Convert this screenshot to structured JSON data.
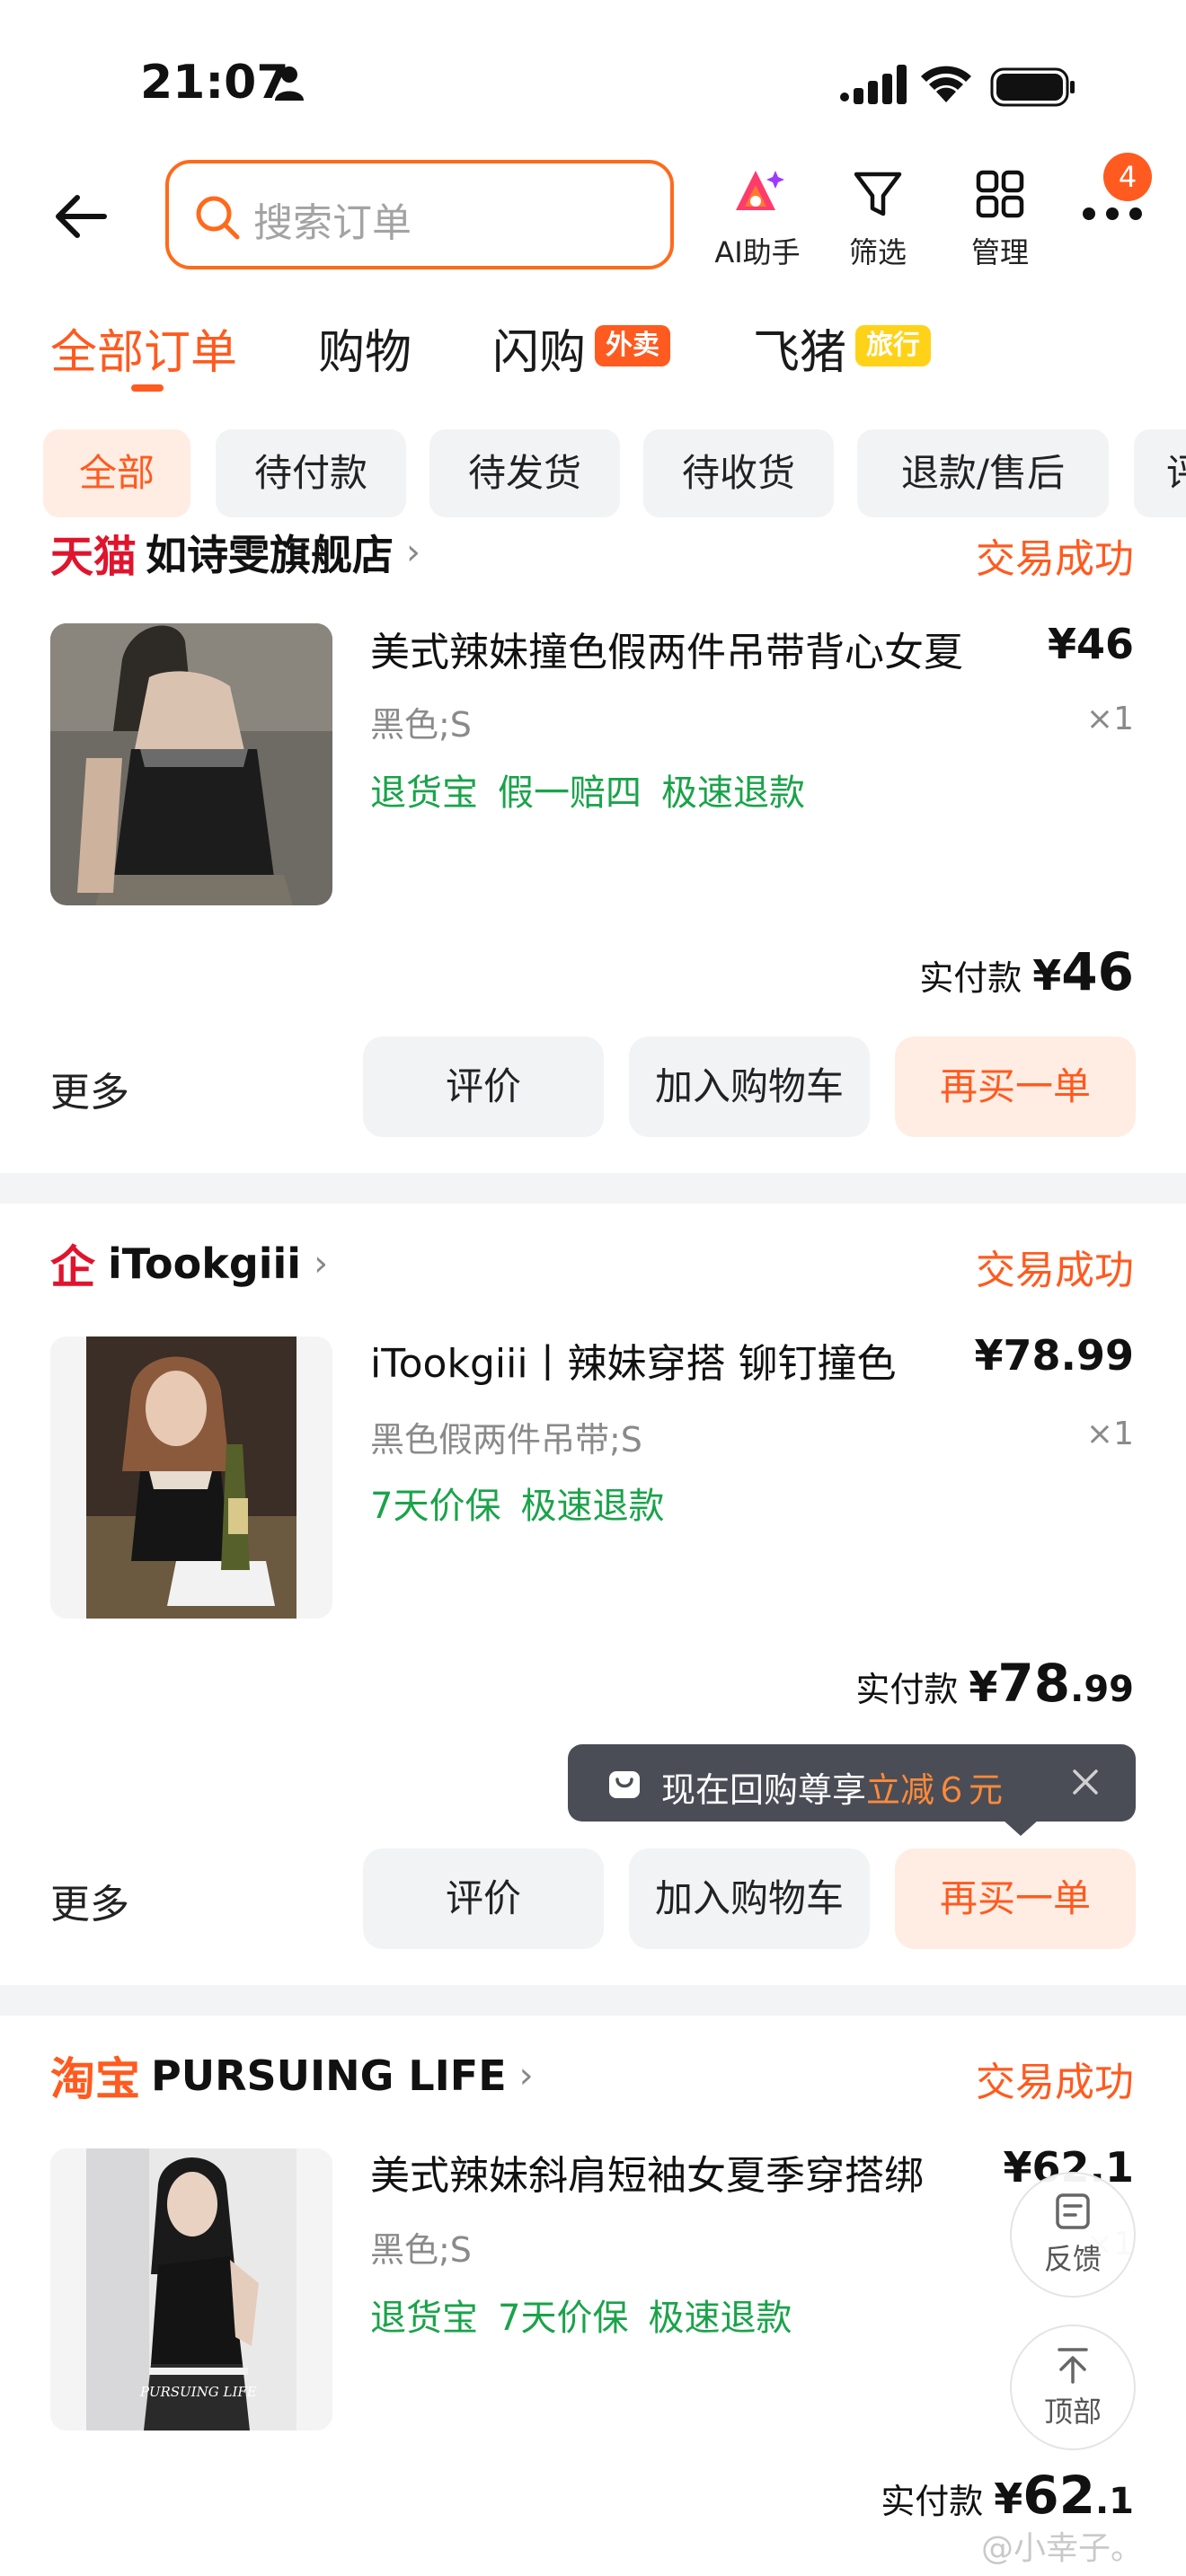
{
  "status_bar": {
    "time": "21:07"
  },
  "header": {
    "search_placeholder": "搜索订单",
    "ai_label": "AI助手",
    "filter_label": "筛选",
    "manage_label": "管理",
    "more_badge": "4"
  },
  "tabs": {
    "all": "全部订单",
    "shopping": "购物",
    "flash": "闪购",
    "flash_tag": "外卖",
    "fliggy": "飞猪",
    "fliggy_tag": "旅行"
  },
  "chips": [
    "全部",
    "待付款",
    "待发货",
    "待收货",
    "退款/售后",
    "评"
  ],
  "orders": [
    {
      "shop_brand": "天猫",
      "shop_name": "如诗雯旗舰店",
      "status": "交易成功",
      "title": "美式辣妹撞色假两件吊带背心女夏",
      "price": "¥46",
      "spec": "黑色;S",
      "qty": "×1",
      "tags": [
        "退货宝",
        "假一赔四",
        "极速退款"
      ],
      "paid_label": "实付款",
      "paid_symbol": "¥",
      "paid_int": "46",
      "paid_dec": "",
      "more": "更多",
      "btn_review": "评价",
      "btn_cart": "加入购物车",
      "btn_rebuy": "再买一单"
    },
    {
      "shop_brand": "企",
      "shop_name": "iTookgiii",
      "status": "交易成功",
      "title": "iTookgiii丨辣妹穿搭 铆钉撞色",
      "price": "¥78.99",
      "spec": "黑色假两件吊带;S",
      "qty": "×1",
      "tags": [
        "7天价保",
        "极速退款"
      ],
      "paid_label": "实付款",
      "paid_symbol": "¥",
      "paid_int": "78",
      "paid_dec": ".99",
      "more": "更多",
      "btn_review": "评价",
      "btn_cart": "加入购物车",
      "btn_rebuy": "再买一单"
    },
    {
      "shop_brand": "淘宝",
      "shop_name": "PURSUING LIFE",
      "status": "交易成功",
      "title": "美式辣妹斜肩短袖女夏季穿搭绑",
      "price": "¥62.1",
      "spec": "黑色;S",
      "qty": "×1",
      "tags": [
        "退货宝",
        "7天价保",
        "极速退款"
      ],
      "paid_label": "实付款",
      "paid_symbol": "¥",
      "paid_int": "62",
      "paid_dec": ".1",
      "thumb_caption": "PURSUING LIFE"
    }
  ],
  "tooltip": {
    "text": "现在回购尊享",
    "highlight": "立减６元"
  },
  "floating": {
    "feedback": "反馈",
    "top": "顶部"
  },
  "watermark": "@小幸子。",
  "colors": {
    "accent": "#ff5a1f",
    "green": "#1aa34a",
    "tmall_red": "#e0142c"
  }
}
